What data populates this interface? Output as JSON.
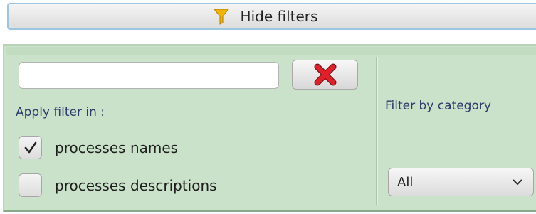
{
  "toggle": {
    "label": "Hide filters",
    "icon": "funnel-icon"
  },
  "filter": {
    "search_value": "",
    "clear_icon": "red-x-icon",
    "apply_label": "Apply filter in :",
    "options": [
      {
        "label": "processes names",
        "checked": true
      },
      {
        "label": "processes descriptions",
        "checked": false
      }
    ]
  },
  "category": {
    "label": "Filter by category",
    "selected": "All"
  },
  "colors": {
    "panel_bg": "#c9e2c9",
    "label_text": "#2b3b6b",
    "clear_x": "#e0202a",
    "funnel": "#f5b400"
  }
}
